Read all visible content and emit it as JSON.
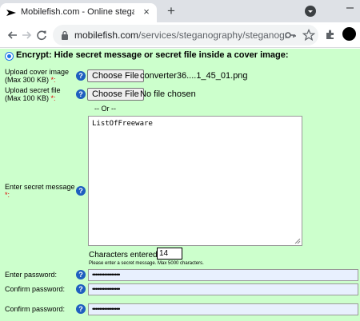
{
  "browser": {
    "tab_title": "Mobilefish.com - Online steganography",
    "tab_close": "×",
    "new_tab": "+",
    "url_host": "mobilefish.com",
    "url_path": "/services/steganography/steganograph..."
  },
  "form": {
    "encrypt_label": "Encrypt: Hide secret message or secret file inside a cover image:",
    "cover_image": {
      "label_line1": "Upload cover image",
      "label_line2": "(Max 300 KB)",
      "required": "*:",
      "button": "Choose File",
      "file_name": "converter36....1_45_01.png"
    },
    "secret_file": {
      "label_line1": "Upload secret file",
      "label_line2": "(Max 100 KB)",
      "required": "*:",
      "button": "Choose File",
      "file_name": "No file chosen"
    },
    "or_text": "-- Or --",
    "secret_message": {
      "label": "Enter secret message",
      "required": "*:",
      "value": "ListOfFreeware"
    },
    "chars_label": "Characters entered:",
    "chars_count": "14",
    "hint": "Please enter a secret message. Max 5000 characters.",
    "help_glyph": "?",
    "enter_password": {
      "label": "Enter password:",
      "value": "••••••••••••••••"
    },
    "confirm_password": {
      "label": "Confirm password:",
      "value": "••••••••••••••••"
    },
    "confirm_password2": {
      "label": "Confirm password:",
      "value": "••••••••••••••••"
    }
  },
  "colors": {
    "page_background": "#ccffcc",
    "help_icon": "#1f5fbf",
    "autofill_field": "#e8f0fe"
  }
}
